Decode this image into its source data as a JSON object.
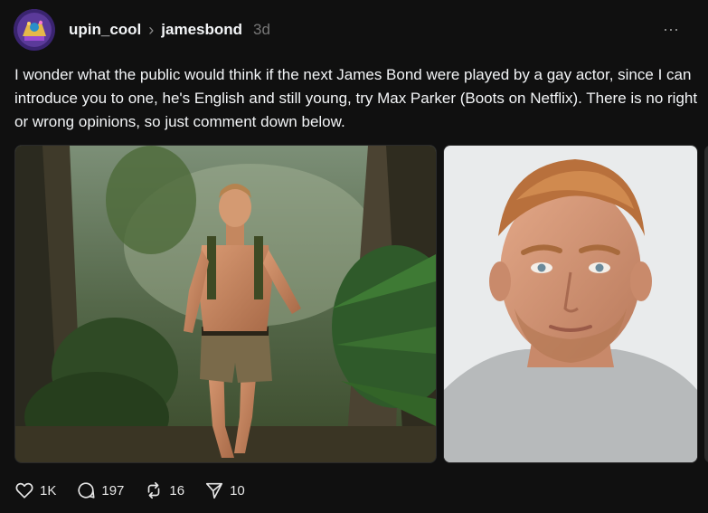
{
  "post": {
    "username": "upin_cool",
    "separator": "›",
    "topic": "jamesbond",
    "time": "3d",
    "more": "···",
    "text": "I wonder what the public would think if the next James Bond were played by a gay actor, since I can introduce you to one, he's English and still young, try Max Parker (Boots on Netflix). There is no right or wrong opinions, so just comment down below."
  },
  "actions": {
    "likes": "1K",
    "comments": "197",
    "reposts": "16",
    "shares": "10"
  },
  "icons": {
    "like": "heart-icon",
    "comment": "comment-bubble-icon",
    "repost": "repost-arrows-icon",
    "share": "send-icon",
    "more": "more-dots-icon"
  },
  "colors": {
    "background": "#101010",
    "text": "#f3f5f7",
    "muted": "#777777"
  }
}
